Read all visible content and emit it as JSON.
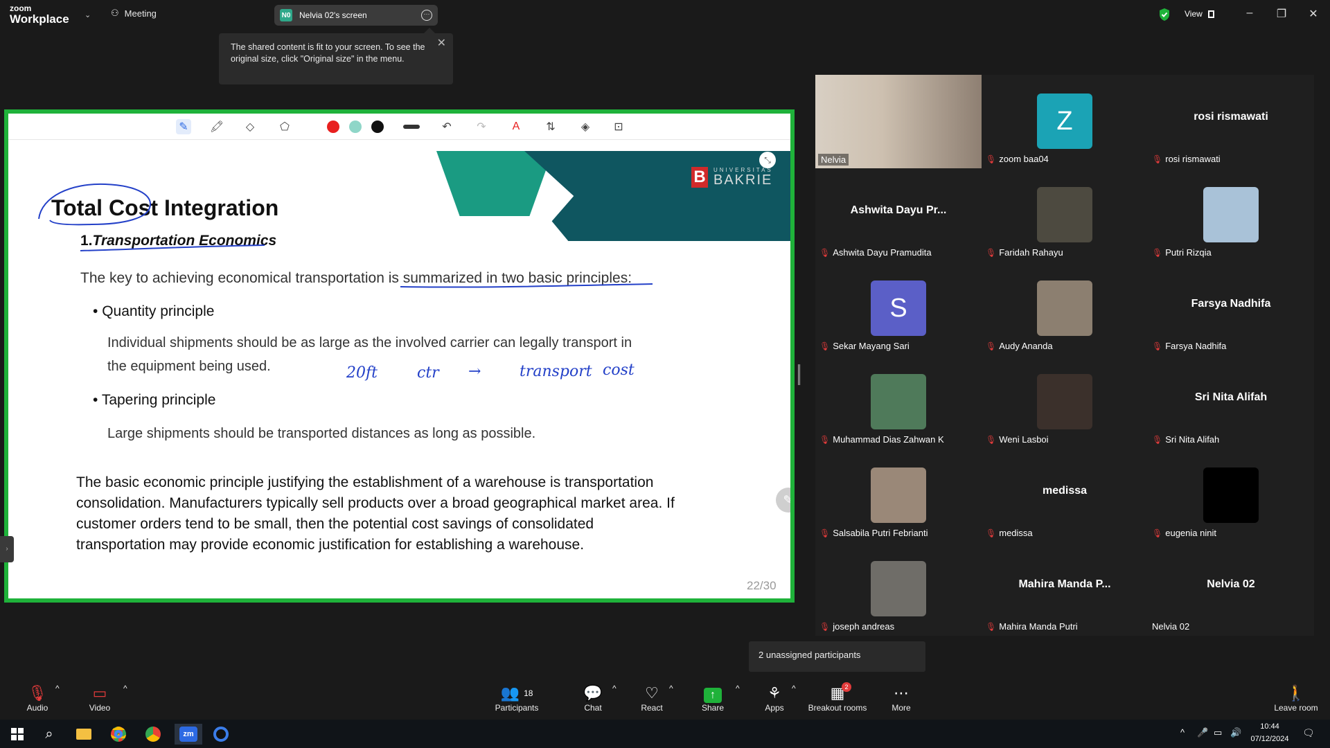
{
  "app": {
    "brand_line1": "zoom",
    "brand_line2": "Workplace",
    "meeting_label": "Meeting",
    "screen_label": "Nelvia 02's screen",
    "screen_badge": "N0",
    "view_label": "View"
  },
  "tooltip": {
    "line1": "The shared content is fit to your screen. To see the",
    "line2": "original size, click \"Original size\" in the menu."
  },
  "slide": {
    "logo_small": "UNIVERSITAS",
    "logo_big": "BAKRIE",
    "logo_letter": "B",
    "title": "Total Cost Integration",
    "subtitle_num": "1.",
    "subtitle_text": "Transportation Economics",
    "intro": "The key to achieving economical transportation is summarized in two basic principles:",
    "bullet1": "Quantity principle",
    "bullet1_body1": "Individual shipments should be as large as the involved carrier can legally transport in",
    "bullet1_body2": "the equipment being used.",
    "bullet2": "Tapering principle",
    "bullet2_body": "Large shipments should be transported distances as long as possible.",
    "para1": "The basic economic principle justifying the establishment of a warehouse is transportation",
    "para2": "consolidation. Manufacturers typically sell products over a broad geographical market area. If",
    "para3": "customer orders tend to be small, then the potential cost savings of consolidated",
    "para4": "transportation may provide economic justification for establishing a warehouse.",
    "page": "22/30",
    "handwriting": {
      "a": "20ft",
      "b": "ctr",
      "c": "→",
      "d": "transport",
      "e": "cost"
    }
  },
  "colors": {
    "share_border": "#1fb23a",
    "pen_red": "#e8201f",
    "pen_teal": "#8fd6c8",
    "pen_black": "#111111",
    "slide_green": "#1a9b82",
    "slide_dark": "#0f5660",
    "ink_blue": "#2340c8"
  },
  "participants": [
    {
      "name": "Nelvia",
      "type": "video"
    },
    {
      "name": "zoom baa04",
      "type": "letter",
      "letter": "Z",
      "color": "#1ba3b5"
    },
    {
      "name": "rosi rismawati",
      "type": "name",
      "big": "rosi rismawati"
    },
    {
      "name": "Ashwita Dayu Pramudita",
      "type": "name",
      "big": "Ashwita Dayu Pr..."
    },
    {
      "name": "Faridah Rahayu",
      "type": "photo",
      "color": "#4d4a40"
    },
    {
      "name": "Putri Rizqia",
      "type": "photo",
      "color": "#a9c2d8"
    },
    {
      "name": "Sekar Mayang Sari",
      "type": "letter",
      "letter": "S",
      "color": "#5b5fc7"
    },
    {
      "name": "Audy Ananda",
      "type": "photo",
      "color": "#8c7f70"
    },
    {
      "name": "Farsya Nadhifa",
      "type": "name",
      "big": "Farsya Nadhifa"
    },
    {
      "name": "Muhammad Dias Zahwan K",
      "type": "photo",
      "color": "#4f7a5a"
    },
    {
      "name": "Weni Lasboi",
      "type": "photo",
      "color": "#3b302b"
    },
    {
      "name": "Sri Nita Alifah",
      "type": "name",
      "big": "Sri Nita Alifah"
    },
    {
      "name": "Salsabila Putri Febrianti",
      "type": "photo",
      "color": "#9a8878"
    },
    {
      "name": "medissa",
      "type": "name",
      "big": "medissa"
    },
    {
      "name": "eugenia ninit",
      "type": "photo",
      "color": "#000000"
    },
    {
      "name": "joseph andreas",
      "type": "photo",
      "color": "#6f6d68"
    },
    {
      "name": "Mahira Manda Putri",
      "type": "name",
      "big": "Mahira Manda P..."
    },
    {
      "name": "Nelvia 02",
      "type": "name",
      "big": "Nelvia 02",
      "no_mic": true
    }
  ],
  "unassigned": "2 unassigned participants",
  "controls": {
    "audio": "Audio",
    "video": "Video",
    "participants": "Participants",
    "participant_count": "18",
    "chat": "Chat",
    "react": "React",
    "share": "Share",
    "apps": "Apps",
    "breakout": "Breakout rooms",
    "breakout_badge": "2",
    "more": "More",
    "leave": "Leave room"
  },
  "taskbar": {
    "time": "10:44",
    "date": "07/12/2024",
    "zoom_label": "zm"
  },
  "icons": [
    "meeting-icon",
    "shield-icon",
    "view-icon",
    "minimize-icon",
    "restore-icon",
    "close-icon",
    "pen-icon",
    "highlighter-icon",
    "eraser-icon",
    "lasso-icon",
    "undo-icon",
    "redo-icon",
    "text-icon",
    "format-icon",
    "shapes-icon",
    "clear-icon",
    "mic-off-icon",
    "video-off-icon",
    "participants-icon",
    "chat-icon",
    "react-icon",
    "share-icon",
    "apps-icon",
    "breakout-icon",
    "more-icon",
    "leave-icon",
    "windows-icon",
    "search-icon"
  ]
}
